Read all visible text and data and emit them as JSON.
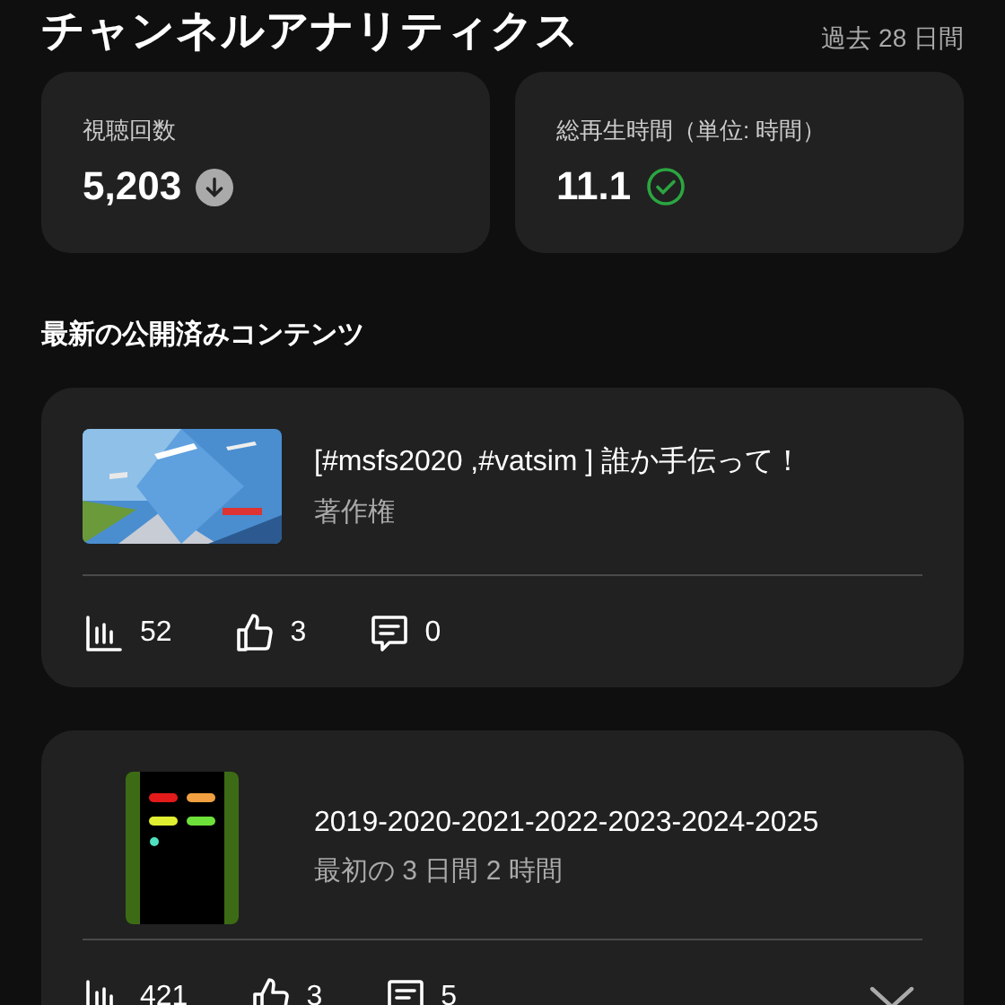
{
  "header": {
    "title": "チャンネルアナリティクス",
    "period": "過去 28 日間"
  },
  "stats": [
    {
      "label": "視聴回数",
      "value": "5,203",
      "kind": "down"
    },
    {
      "label": "総再生時間（単位: 時間）",
      "value": "11.1",
      "kind": "check"
    }
  ],
  "section_title": "最新の公開済みコンテンツ",
  "videos": [
    {
      "title": "[#msfs2020 ,#vatsim ] 誰か手伝って！",
      "subtitle": "著作権",
      "thumbnail": {
        "kind": "landscape"
      },
      "views": "52",
      "likes": "3",
      "comments": "0",
      "expandable": false
    },
    {
      "title": "2019-2020-2021-2022-2023-2024-2025",
      "subtitle": "最初の 3 日間 2 時間",
      "thumbnail": {
        "kind": "portrait"
      },
      "views": "421",
      "likes": "3",
      "comments": "5",
      "expandable": true
    }
  ]
}
